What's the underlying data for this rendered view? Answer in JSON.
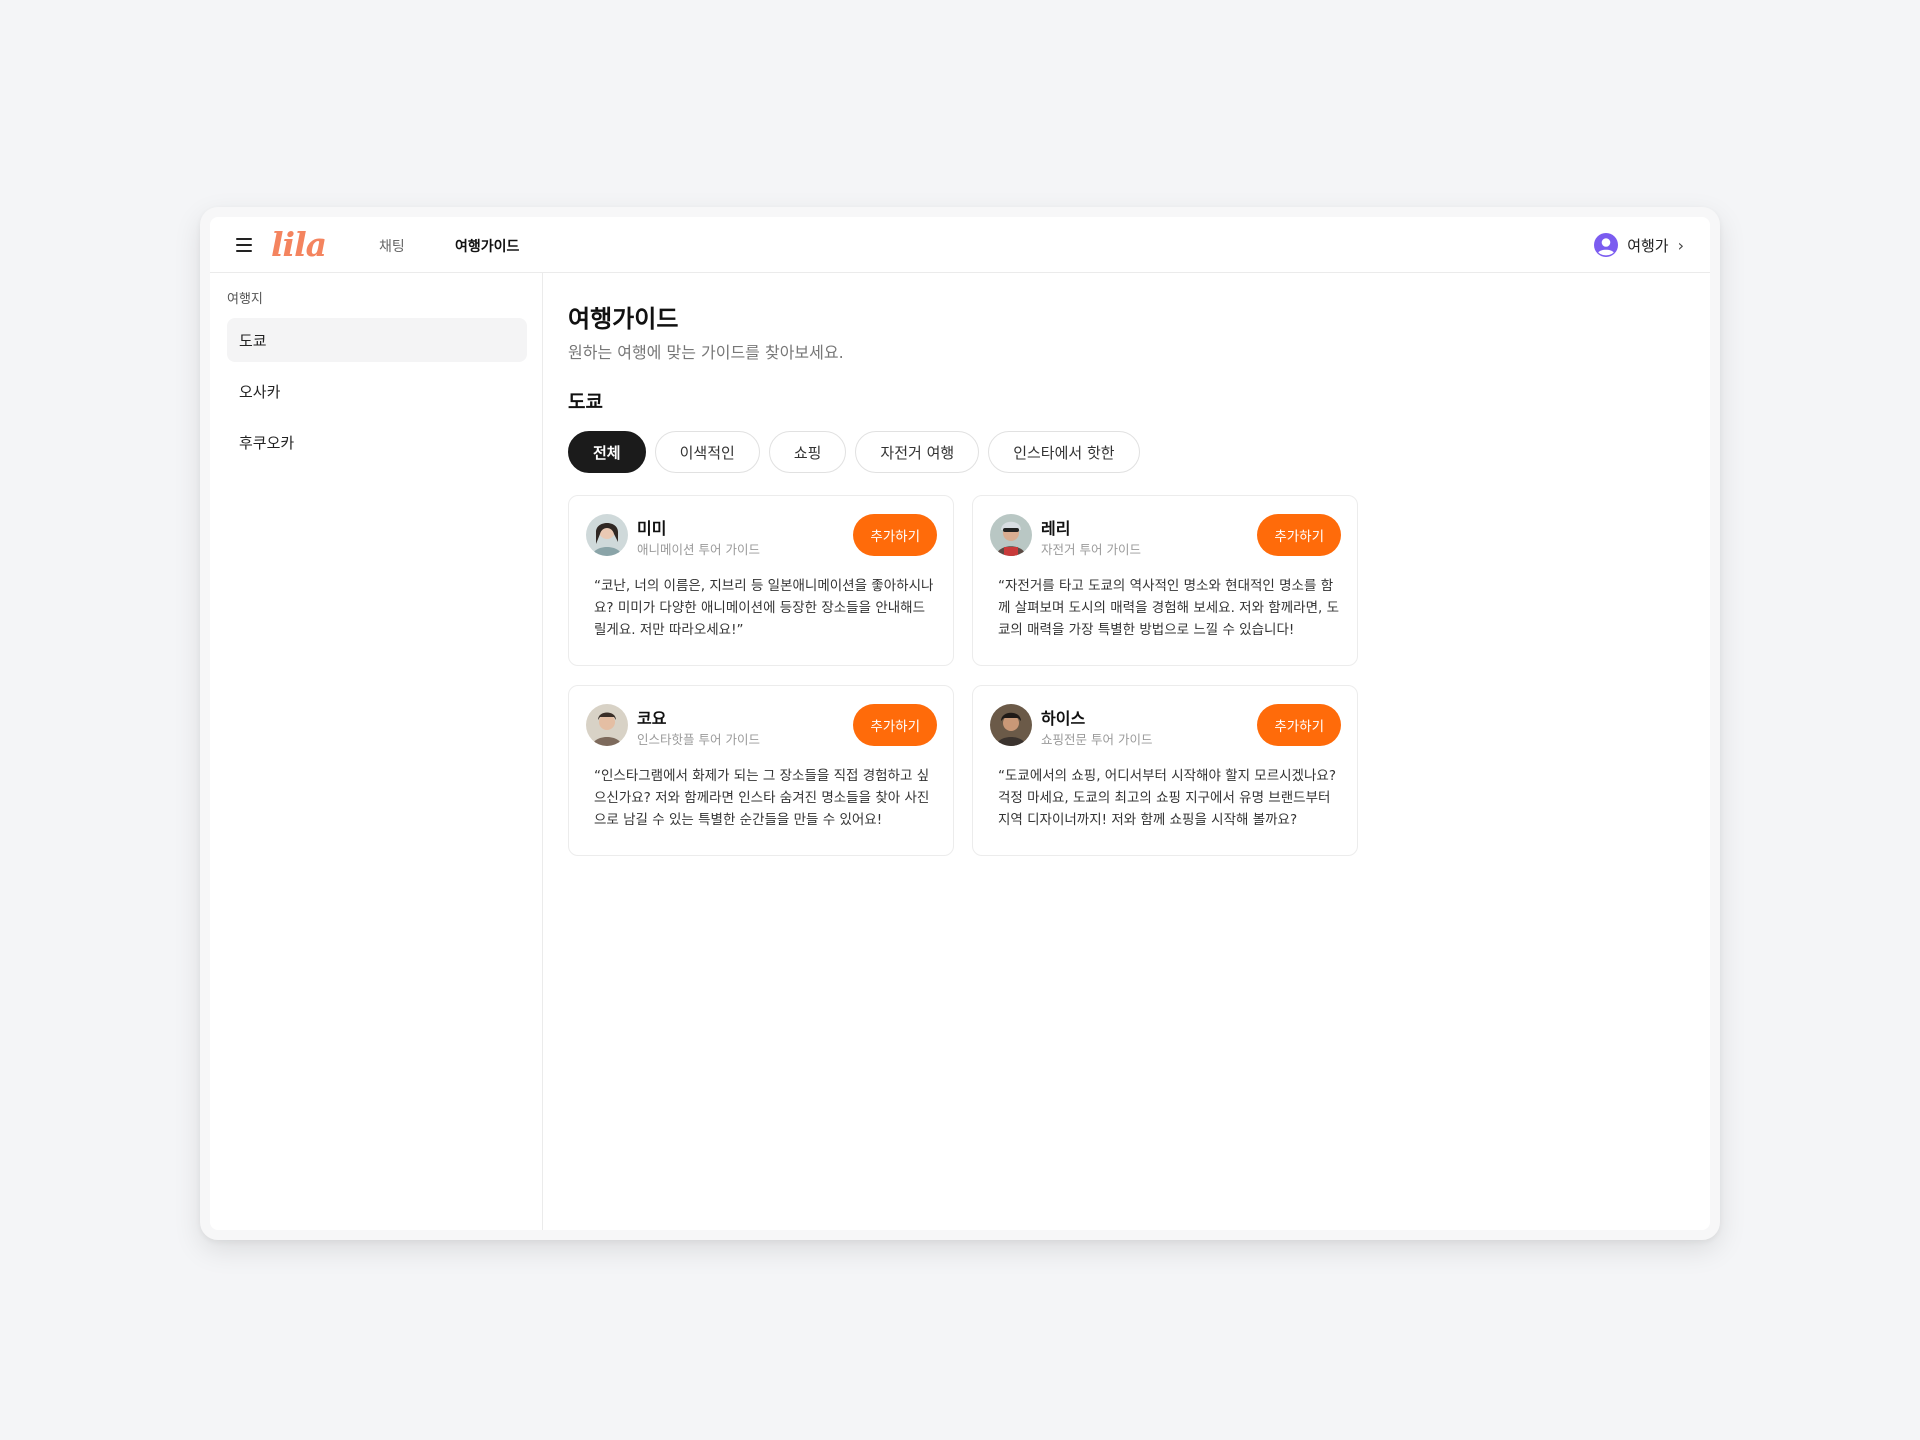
{
  "app": {
    "logo": "lila"
  },
  "header": {
    "nav": [
      {
        "label": "채팅",
        "active": false
      },
      {
        "label": "여행가이드",
        "active": true
      }
    ],
    "user": {
      "name": "여행가"
    }
  },
  "sidebar": {
    "heading": "여행지",
    "items": [
      {
        "label": "도쿄",
        "selected": true
      },
      {
        "label": "오사카",
        "selected": false
      },
      {
        "label": "후쿠오카",
        "selected": false
      }
    ]
  },
  "main": {
    "title": "여행가이드",
    "subtitle": "원하는 여행에 맞는 가이드를 찾아보세요.",
    "section_title": "도쿄",
    "filters": [
      {
        "label": "전체",
        "active": true
      },
      {
        "label": "이색적인",
        "active": false
      },
      {
        "label": "쇼핑",
        "active": false
      },
      {
        "label": "자전거 여행",
        "active": false
      },
      {
        "label": "인스타에서 핫한",
        "active": false
      }
    ],
    "cards": [
      {
        "name": "미미",
        "role": "애니메이션 투어 가이드",
        "button": "추가하기",
        "quote": "“코난, 너의 이름은, 지브리 등 일본애니메이션을 좋아하시나요? 미미가 다양한 애니메이션에 등장한 장소들을 안내해드릴게요. 저만 따라오세요!”",
        "avatar_color": "#8aa4a8"
      },
      {
        "name": "레리",
        "role": "자전거 투어 가이드",
        "button": "추가하기",
        "quote": "“자전거를 타고 도쿄의 역사적인 명소와 현대적인 명소를 함께 살펴보며 도시의 매력을 경험해 보세요. 저와 함께라면, 도쿄의 매력을 가장 특별한 방법으로 느낄 수 있습니다!",
        "avatar_color": "#5c4a44"
      },
      {
        "name": "코요",
        "role": "인스타핫플 투어 가이드",
        "button": "추가하기",
        "quote": "“인스타그램에서 화제가 되는 그 장소들을 직접 경험하고 싶으신가요? 저와 함께라면 인스타 숨겨진 명소들을 찾아 사진으로 남길 수 있는 특별한 순간들을 만들 수 있어요!",
        "avatar_color": "#7d6a5c"
      },
      {
        "name": "하이스",
        "role": "쇼핑전문 투어 가이드",
        "button": "추가하기",
        "quote": "“도쿄에서의 쇼핑, 어디서부터 시작해야 할지 모르시겠나요? 걱정 마세요, 도쿄의 최고의 쇼핑 지구에서 유명 브랜드부터 지역 디자이너까지! 저와 함께 쇼핑을 시작해 볼까요?",
        "avatar_color": "#3b332e"
      }
    ]
  },
  "colors": {
    "accent": "#ff6b0a",
    "logo": "#f4845f",
    "user_icon": "#7b5cf0"
  }
}
